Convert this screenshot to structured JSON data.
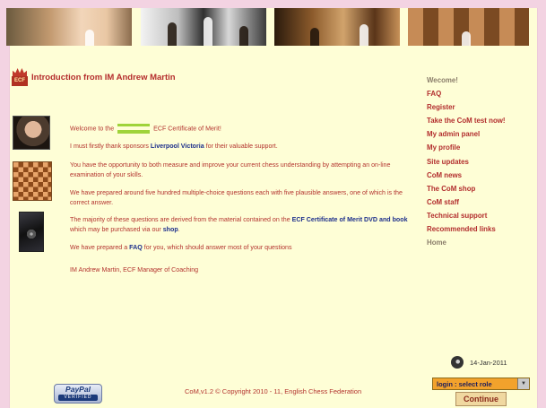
{
  "heading": {
    "title": "Introduction from IM Andrew Martin"
  },
  "intro": {
    "welcome_pre": "Welcome to the",
    "welcome_post": "ECF Certificate of Merit!",
    "sponsor_pre": "I must firstly thank sponsors",
    "sponsor_link": "Liverpool Victoria",
    "sponsor_post": "for their valuable support.",
    "p_measure": "You have the opportunity to both measure and improve your current chess understanding by attempting an on-line examination of your skills.",
    "p_questions": "We have prepared around five hundred multiple-choice questions each with five plausible answers, one of which is the correct answer.",
    "derived_pre": "The majority of these questions are derived from the material contained on the",
    "derived_link": "ECF Certificate of Merit DVD and book",
    "derived_mid": "which may be purchased via our",
    "derived_shop": "shop",
    "derived_end": ".",
    "faq_pre": "We have prepared a",
    "faq_link": "FAQ",
    "faq_post": "for you, which should answer most of your questions",
    "signature": "IM Andrew Martin, ECF Manager of Coaching"
  },
  "sidebar": {
    "items": [
      {
        "label": "Wecome!"
      },
      {
        "label": "FAQ"
      },
      {
        "label": "Register"
      },
      {
        "label": "Take the CoM test now!"
      },
      {
        "label": "My admin panel"
      },
      {
        "label": "My profile"
      },
      {
        "label": "Site updates"
      },
      {
        "label": "CoM news"
      },
      {
        "label": "The CoM shop"
      },
      {
        "label": "CoM staff"
      },
      {
        "label": "Technical support"
      },
      {
        "label": "Recommended links"
      },
      {
        "label": "Home"
      }
    ]
  },
  "date": "14-Jan-2011",
  "paypal": {
    "line1": "PayPal",
    "line2": "VERIFIED"
  },
  "footer": {
    "copyright": "CoM,v1.2 © Copyright 2010 - 11, English Chess Federation"
  },
  "role": {
    "selected": "login : select role",
    "continue_label": "Continue"
  },
  "logo": {
    "text": "ECF"
  },
  "colors": {
    "background": "#fefed6",
    "border": "#f3d3e2",
    "text_red": "#b3332e",
    "link_blue": "#1d2f8b",
    "select_orange": "#f2a22c"
  }
}
